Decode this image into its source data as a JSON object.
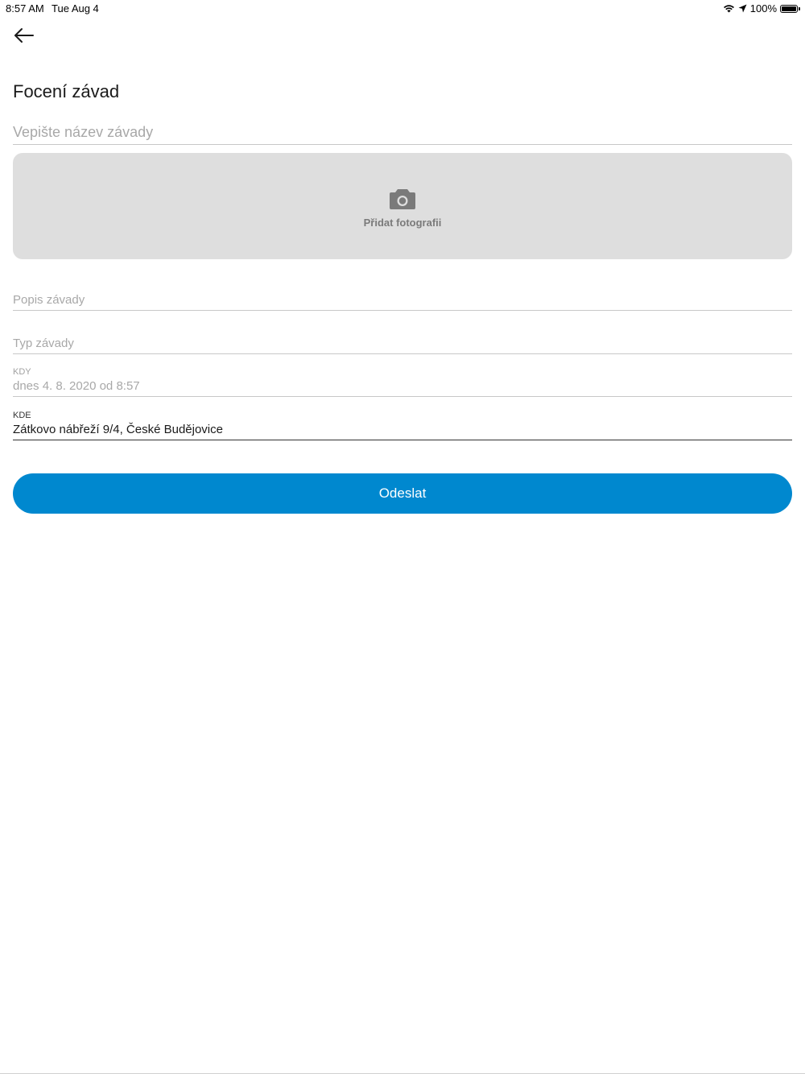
{
  "status_bar": {
    "time": "8:57 AM",
    "date": "Tue Aug 4",
    "battery": "100%",
    "battery_level": 1.0,
    "icons": [
      "wifi-icon",
      "location-arrow-icon",
      "battery-icon"
    ]
  },
  "header": {
    "back_icon": "arrow-left-icon",
    "title": "Focení závad"
  },
  "form": {
    "name_placeholder": "Vepište název závady",
    "name_value": "",
    "photo": {
      "icon": "camera-icon",
      "label": "Přidat fotografii"
    },
    "popis": {
      "placeholder": "Popis závady"
    },
    "typ": {
      "placeholder": "Typ závady"
    },
    "kdy": {
      "label": "KDY",
      "value": "dnes 4. 8. 2020 od 8:57"
    },
    "kde": {
      "label": "KDE",
      "value": "Zátkovo nábřeží 9/4, České Budějovice"
    },
    "submit_label": "Odeslat"
  },
  "colors": {
    "accent": "#0088cf",
    "photo_bg": "#dedede",
    "placeholder": "#a8a8a8"
  }
}
